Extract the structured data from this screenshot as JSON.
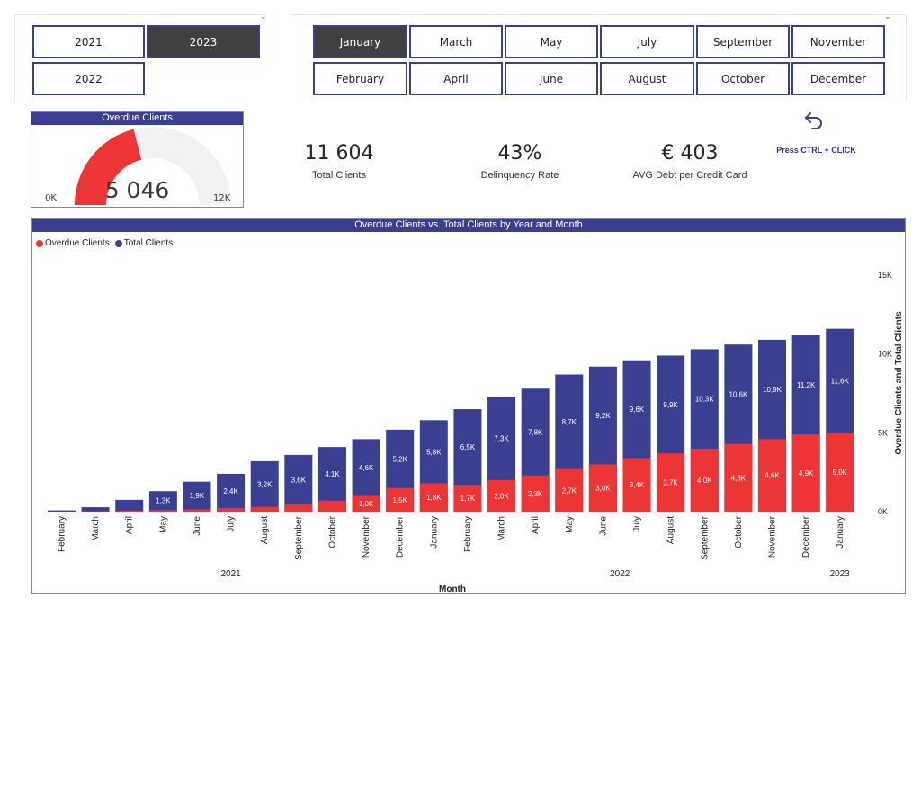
{
  "year_slicer": {
    "items": [
      {
        "label": "2021",
        "selected": false
      },
      {
        "label": "2023",
        "selected": true
      },
      {
        "label": "2022",
        "selected": false
      }
    ]
  },
  "month_slicer": {
    "items": [
      {
        "label": "January",
        "selected": true
      },
      {
        "label": "March",
        "selected": false
      },
      {
        "label": "May",
        "selected": false
      },
      {
        "label": "July",
        "selected": false
      },
      {
        "label": "September",
        "selected": false
      },
      {
        "label": "November",
        "selected": false
      },
      {
        "label": "February",
        "selected": false
      },
      {
        "label": "April",
        "selected": false
      },
      {
        "label": "June",
        "selected": false
      },
      {
        "label": "August",
        "selected": false
      },
      {
        "label": "October",
        "selected": false
      },
      {
        "label": "December",
        "selected": false
      }
    ]
  },
  "gauge": {
    "title": "Overdue Clients",
    "value_label": "5 046",
    "value": 5046,
    "min_label": "0K",
    "max_label": "12K",
    "min": 0,
    "max": 12000,
    "fill_color": "#ee3536",
    "track_color": "#f1f1f1"
  },
  "kpis": [
    {
      "value": "11 604",
      "label": "Total Clients"
    },
    {
      "value": "43%",
      "label": "Delinquency Rate"
    },
    {
      "value": "€ 403",
      "label": "AVG Debt per Credit Card"
    }
  ],
  "reset": {
    "icon": "undo-arrow-icon",
    "hint": "Press CTRL + CLICK"
  },
  "chart": {
    "title": "Overdue Clients vs. Total Clients by Year and Month",
    "legend": [
      {
        "label": "Overdue Clients",
        "color": "#ee3536"
      },
      {
        "label": "Total Clients",
        "color": "#3b3f91"
      }
    ]
  },
  "chart_data": {
    "type": "bar",
    "stacked": true,
    "title": "Overdue Clients vs. Total Clients by Year and Month",
    "xlabel": "Month",
    "ylabel": "Overdue Clients and Total Clients",
    "ylim": [
      0,
      17000
    ],
    "y_ticks": [
      {
        "value": 0,
        "label": "0K"
      },
      {
        "value": 5000,
        "label": "5K"
      },
      {
        "value": 10000,
        "label": "10K"
      },
      {
        "value": 15000,
        "label": "15K"
      }
    ],
    "categories": [
      "February",
      "March",
      "April",
      "May",
      "June",
      "July",
      "August",
      "September",
      "October",
      "November",
      "December",
      "January",
      "February",
      "March",
      "April",
      "May",
      "June",
      "July",
      "August",
      "September",
      "October",
      "November",
      "December",
      "January"
    ],
    "year_groups": [
      {
        "label": "2021",
        "start": 0,
        "end": 10
      },
      {
        "label": "2022",
        "start": 11,
        "end": 22
      },
      {
        "label": "2023",
        "start": 23,
        "end": 23
      }
    ],
    "legend_position": "top-left",
    "series": [
      {
        "name": "Overdue Clients",
        "color": "#ee3536",
        "values": [
          10,
          30,
          60,
          100,
          150,
          220,
          300,
          450,
          700,
          1000,
          1500,
          1800,
          1700,
          2000,
          2300,
          2700,
          3000,
          3400,
          3700,
          4000,
          4300,
          4600,
          4900,
          5000
        ],
        "labels": [
          "",
          "",
          "",
          "",
          "",
          "",
          "",
          "",
          "",
          "1,0K",
          "1,5K",
          "1,8K",
          "1,7K",
          "2,0K",
          "2,3K",
          "2,7K",
          "3,0K",
          "3,4K",
          "3,7K",
          "4,0K",
          "4,3K",
          "4,6K",
          "4,9K",
          "5,0K"
        ]
      },
      {
        "name": "Total Clients",
        "color": "#3b3f91",
        "values": [
          80,
          280,
          750,
          1300,
          1900,
          2400,
          3200,
          3600,
          4100,
          4600,
          5200,
          5800,
          6500,
          7300,
          7800,
          8700,
          9200,
          9600,
          9900,
          10300,
          10600,
          10900,
          11200,
          11600
        ],
        "labels": [
          "",
          "",
          "",
          "1,3K",
          "1,9K",
          "2,4K",
          "3,2K",
          "3,6K",
          "4,1K",
          "4,6K",
          "5,2K",
          "5,8K",
          "6,5K",
          "7,3K",
          "7,8K",
          "8,7K",
          "9,2K",
          "9,6K",
          "9,9K",
          "10,3K",
          "10,6K",
          "10,9K",
          "11,2K",
          "11,6K"
        ]
      }
    ]
  }
}
